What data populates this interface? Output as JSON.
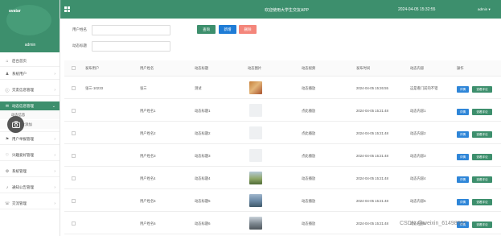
{
  "sidebar": {
    "avatar_text": "avatar",
    "admin_name": "admin",
    "items": [
      {
        "label": "后台首页",
        "icon": "home-icon",
        "expandable": false,
        "active": false
      },
      {
        "label": "系统用户",
        "icon": "user-icon",
        "expandable": true,
        "active": false
      },
      {
        "label": "交友信息管理",
        "icon": "info-icon",
        "expandable": true,
        "active": false
      },
      {
        "label": "动态信息管理",
        "icon": "message-icon",
        "expandable": true,
        "active": true
      },
      {
        "label": "活动信息管理",
        "icon": "calendar-icon",
        "expandable": true,
        "active": false
      },
      {
        "label": "用户举报管理",
        "icon": "flag-icon",
        "expandable": true,
        "active": false
      },
      {
        "label": "兴趣爱好管理",
        "icon": "heart-icon",
        "expandable": true,
        "active": false
      },
      {
        "label": "系统管理",
        "icon": "gear-icon",
        "expandable": true,
        "active": false
      },
      {
        "label": "通知公告管理",
        "icon": "bell-icon",
        "expandable": true,
        "active": false
      },
      {
        "label": "交流管理",
        "icon": "chat-icon",
        "expandable": true,
        "active": false
      }
    ],
    "sub_items": [
      "动态信息",
      "动态图片添加"
    ]
  },
  "topbar": {
    "title": "欢迎使用大学生交友APP",
    "datetime": "2024-04-05 15:32:55",
    "admin_menu": "admin ▾"
  },
  "search": {
    "label1": "用户姓名",
    "label2": "动态标题",
    "input1": "",
    "input2": "",
    "query_label": "查询",
    "add_label": "新增",
    "delete_label": "删除"
  },
  "table": {
    "headers": [
      "发布用户",
      "用户姓名",
      "动态标题",
      "动态图片",
      "动态视频",
      "发布时间",
      "动态内容",
      "操作"
    ],
    "rows": [
      {
        "user": "张三-10233",
        "name": "张三",
        "title": "测试",
        "image": "photo-flower",
        "video": "动态播放",
        "time": "2024-04-05 15:26:55",
        "content": "这是看门前的不错",
        "detail": "详情",
        "review": "查看评论"
      },
      {
        "user": "",
        "name": "用户姓名1",
        "title": "动态标题1",
        "image": "placeholder",
        "video": "点此播放",
        "time": "2024-04-05 15:21:48",
        "content": "动态内容1",
        "detail": "详情",
        "review": "查看评论"
      },
      {
        "user": "",
        "name": "用户姓名2",
        "title": "动态标题2",
        "image": "placeholder",
        "video": "点此播放",
        "time": "2024-04-05 15:21:48",
        "content": "动态内容2",
        "detail": "详情",
        "review": "查看评论"
      },
      {
        "user": "",
        "name": "用户姓名3",
        "title": "动态标题3",
        "image": "placeholder",
        "video": "点此播放",
        "time": "2024-04-05 15:21:48",
        "content": "动态内容3",
        "detail": "详情",
        "review": "查看评论"
      },
      {
        "user": "",
        "name": "用户姓名4",
        "title": "动态标题4",
        "image": "photo-park",
        "video": "动态播放",
        "time": "2024-04-05 15:21:48",
        "content": "动态内容4",
        "detail": "详情",
        "review": "查看评论"
      },
      {
        "user": "",
        "name": "用户姓名5",
        "title": "动态标题5",
        "image": "photo-lake",
        "video": "动态播放",
        "time": "2024-04-05 15:21:48",
        "content": "动态内容5",
        "detail": "详情",
        "review": "查看评论"
      },
      {
        "user": "",
        "name": "用户姓名6",
        "title": "动态标题6",
        "image": "photo-building",
        "video": "动态播放",
        "time": "2024-04-05 15:21:48",
        "content": "动态内容6",
        "detail": "详情",
        "review": "查看评论"
      }
    ]
  },
  "watermark": "CSDN @weixin_61498557",
  "colors": {
    "primary": "#3d8f6d",
    "info": "#2f86d8",
    "add": "#1f7cd6",
    "danger": "#f4867b"
  }
}
